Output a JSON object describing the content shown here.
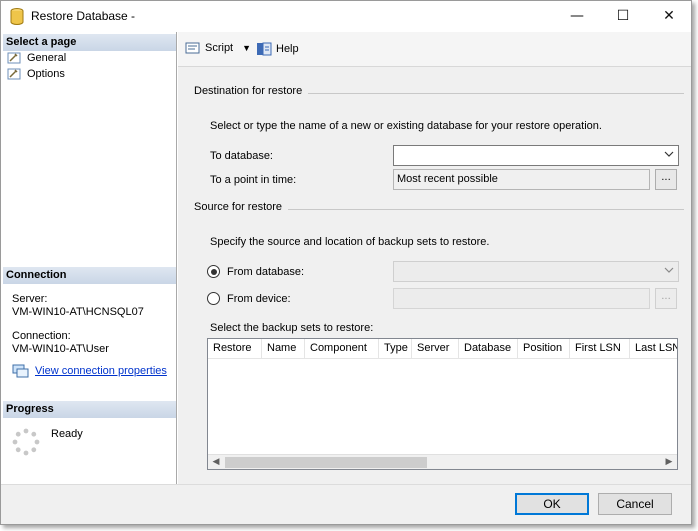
{
  "window": {
    "title": "Restore Database -",
    "minimize_glyph": "—",
    "maximize_glyph": "☐",
    "close_glyph": "✕"
  },
  "left": {
    "select_page_heading": "Select a page",
    "pages": [
      {
        "label": "General",
        "icon": "wrench-page-icon"
      },
      {
        "label": "Options",
        "icon": "wrench-page-icon"
      }
    ],
    "connection_heading": "Connection",
    "server_label": "Server:",
    "server_value": "VM-WIN10-AT\\HCNSQL07",
    "connection_label": "Connection:",
    "connection_value": "VM-WIN10-AT\\User",
    "view_connection_link": "View connection properties",
    "progress_heading": "Progress",
    "progress_status": "Ready"
  },
  "toolbar": {
    "script_label": "Script",
    "help_label": "Help"
  },
  "destination": {
    "group_label": "Destination for restore",
    "description": "Select or type the name of a new or existing database for your restore operation.",
    "to_database_label": "To database:",
    "to_database_value": "",
    "point_in_time_label": "To a point in time:",
    "point_in_time_value": "Most recent possible",
    "browse_label": "..."
  },
  "source": {
    "group_label": "Source for restore",
    "description": "Specify the source and location of backup sets to restore.",
    "from_database_label": "From database:",
    "from_database_value": "",
    "from_device_label": "From device:",
    "from_device_value": "",
    "browse_label": "...",
    "selected_option": "from_database"
  },
  "backup_sets": {
    "label": "Select the backup sets to restore:",
    "columns": [
      "Restore",
      "Name",
      "Component",
      "Type",
      "Server",
      "Database",
      "Position",
      "First LSN",
      "Last LSN"
    ]
  },
  "footer": {
    "ok_label": "OK",
    "cancel_label": "Cancel"
  },
  "colors": {
    "section_header": "#c9d6e6",
    "link": "#0033cc",
    "primary_border": "#0078d7"
  }
}
